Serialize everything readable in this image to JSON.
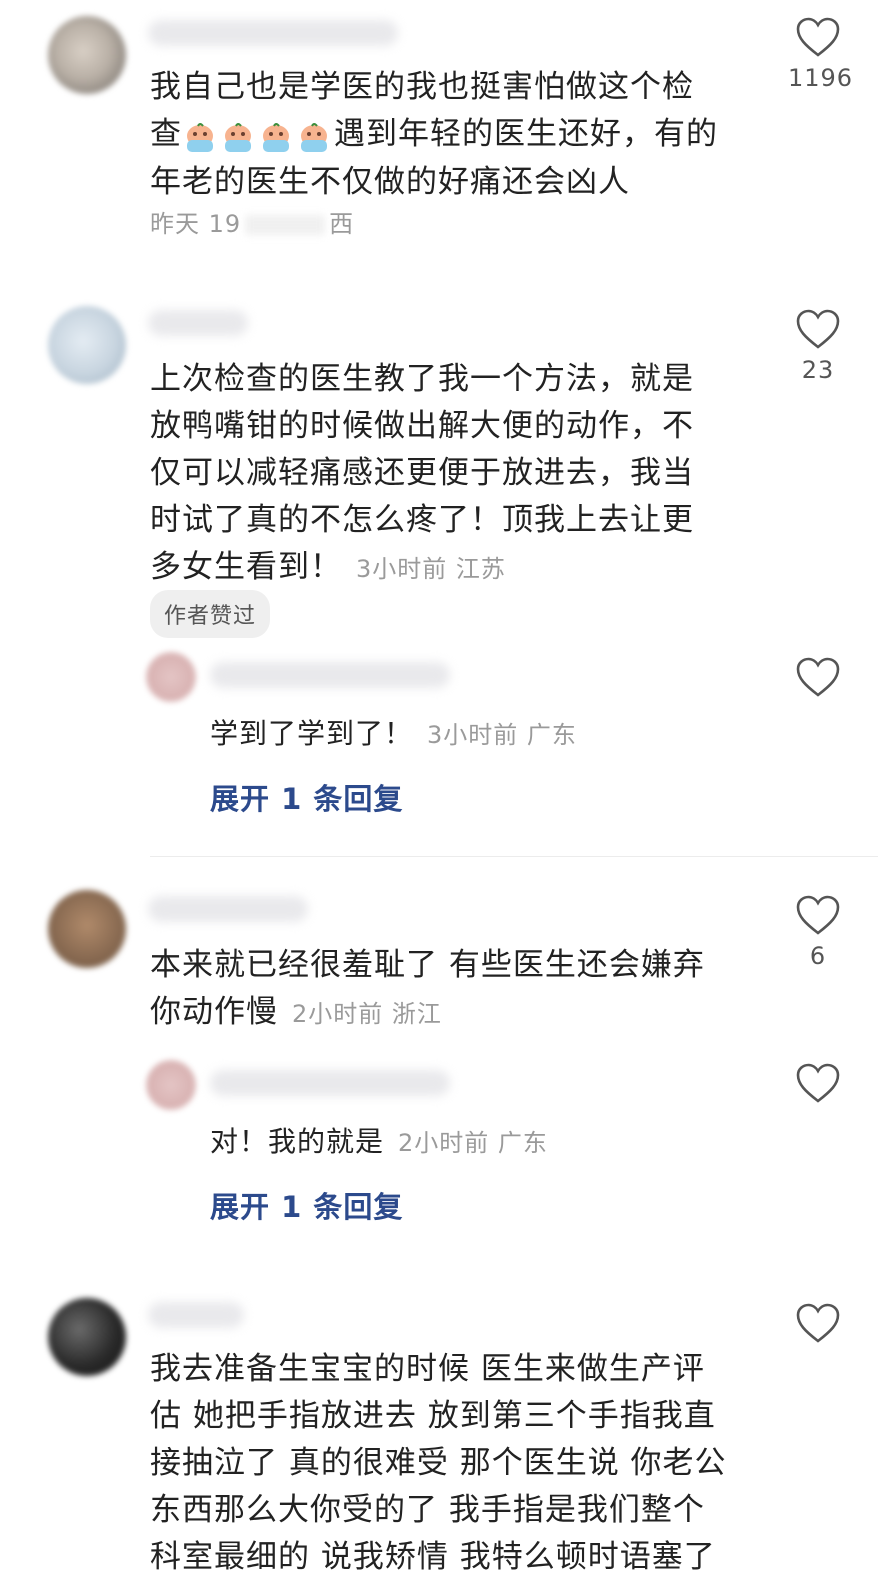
{
  "comments": [
    {
      "text_line1": "我自己也是学医的我也挺害怕做这个检",
      "text_line2_prefix": "查",
      "text_line2_suffix": "遇到年轻的医生还好，有的",
      "text_line3": "年老的医生不仅做的好痛还会凶人",
      "emoji": "crying-face-emoji",
      "meta": "昨天 19",
      "meta_tail": "西",
      "likes": "1196"
    },
    {
      "text_lines": [
        "上次检查的医生教了我一个方法，就是",
        "放鸭嘴钳的时候做出解大便的动作，不",
        "仅可以减轻痛感还更便于放进去，我当",
        "时试了真的不怎么疼了！顶我上去让更"
      ],
      "text_last": "多女生看到！",
      "meta": "3小时前 江苏",
      "badge": "作者赞过",
      "likes": "23",
      "reply": {
        "text": "学到了学到了！",
        "meta": "3小时前 广东"
      },
      "expand": "展开 1 条回复"
    },
    {
      "text_line1": "本来就已经很羞耻了 有些医生还会嫌弃",
      "text_last": "你动作慢",
      "meta": "2小时前 浙江",
      "likes": "6",
      "reply": {
        "text": "对！我的就是",
        "meta": "2小时前 广东"
      },
      "expand": "展开 1 条回复"
    },
    {
      "text_lines": [
        "我去准备生宝宝的时候 医生来做生产评",
        "估 她把手指放进去 放到第三个手指我直",
        "接抽泣了 真的很难受 那个医生说 你老公",
        "东西那么大你受的了 我手指是我们整个",
        "科室最细的 说我矫情 我特么顿时语塞了"
      ]
    }
  ],
  "colors": {
    "link": "#2c4a8c",
    "text": "#222222",
    "meta": "#9a9a9a"
  }
}
